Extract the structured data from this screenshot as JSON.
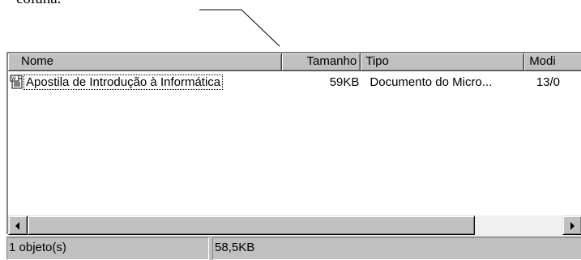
{
  "document": {
    "caption_fragment": "coluna."
  },
  "list": {
    "columns": {
      "name": "Nome",
      "size": "Tamanho",
      "type": "Tipo",
      "modified": "Modi"
    },
    "rows": [
      {
        "name": "Apostila de Introdução à Informática",
        "size": "59KB",
        "type": "Documento do Micro...",
        "modified": "13/0"
      }
    ],
    "file_icon": "word-document-icon"
  },
  "scrollbar": {
    "left_icon": "arrow-left-icon",
    "right_icon": "arrow-right-icon"
  },
  "status": {
    "objects": "1 objeto(s)",
    "size": "58,5KB"
  },
  "colors": {
    "face": "#c0c0c0",
    "shadow": "#808080",
    "text": "#000000"
  }
}
